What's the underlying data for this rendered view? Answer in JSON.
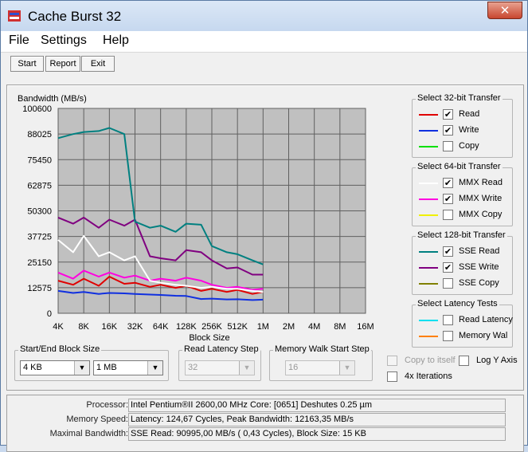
{
  "window": {
    "title": "Cache Burst 32",
    "close_label": "✕"
  },
  "menu": [
    "File",
    "Settings",
    "Help"
  ],
  "toolbar": {
    "start": "Start",
    "report": "Report",
    "exit": "Exit"
  },
  "chart": {
    "ylabel": "Bandwidth (MB/s)",
    "xlabel": "Block Size"
  },
  "chart_data": {
    "type": "line",
    "title": "",
    "ylabel": "Bandwidth (MB/s)",
    "xlabel": "Block Size",
    "ylim": [
      0,
      100600
    ],
    "y_ticks": [
      "100600",
      "88025",
      "75450",
      "62875",
      "50300",
      "37725",
      "25150",
      "12575",
      "0"
    ],
    "x_ticks": [
      "4K",
      "8K",
      "16K",
      "32K",
      "64K",
      "128K",
      "256K",
      "512K",
      "1M",
      "2M",
      "4M",
      "8M",
      "16M"
    ],
    "x_scale": "log2",
    "grid": true,
    "series": [
      {
        "name": "Read",
        "color": "#e00000",
        "x_kb": [
          4,
          6,
          8,
          12,
          16,
          24,
          32,
          48,
          64,
          96,
          128,
          192,
          256,
          384,
          512,
          768,
          1024
        ],
        "values": [
          16000,
          14000,
          17000,
          13500,
          18000,
          14500,
          15000,
          13000,
          14000,
          12500,
          13500,
          11000,
          12000,
          10500,
          11500,
          9500,
          10500
        ]
      },
      {
        "name": "Write",
        "color": "#1030e0",
        "x_kb": [
          4,
          6,
          8,
          12,
          16,
          24,
          32,
          48,
          64,
          96,
          128,
          192,
          256,
          384,
          512,
          768,
          1024
        ],
        "values": [
          11000,
          10000,
          10500,
          9500,
          10000,
          9800,
          9500,
          9200,
          9000,
          8600,
          8500,
          7000,
          7200,
          6800,
          6900,
          6500,
          6700
        ]
      },
      {
        "name": "MMX Read",
        "color": "#ffffff",
        "x_kb": [
          4,
          6,
          8,
          12,
          16,
          24,
          32,
          48,
          64,
          96,
          128,
          192,
          256,
          384,
          512,
          768,
          1024
        ],
        "values": [
          36000,
          30000,
          38000,
          28000,
          30000,
          26000,
          28000,
          16000,
          15000,
          14000,
          13500,
          12500,
          13000,
          12000,
          12000,
          11000,
          10500
        ]
      },
      {
        "name": "MMX Write",
        "color": "#ff00e0",
        "x_kb": [
          4,
          6,
          8,
          12,
          16,
          24,
          32,
          48,
          64,
          96,
          128,
          192,
          256,
          384,
          512,
          768,
          1024
        ],
        "values": [
          20000,
          17000,
          21000,
          18000,
          20000,
          17500,
          18500,
          16000,
          17000,
          16000,
          17500,
          16000,
          14000,
          12500,
          13000,
          11500,
          12000
        ]
      },
      {
        "name": "SSE Read",
        "color": "#008080",
        "x_kb": [
          4,
          6,
          8,
          12,
          16,
          24,
          32,
          48,
          64,
          96,
          128,
          192,
          256,
          384,
          512,
          768,
          1024
        ],
        "values": [
          86000,
          88000,
          89000,
          89500,
          91000,
          88000,
          45000,
          42000,
          43000,
          40000,
          44000,
          43500,
          33000,
          30000,
          29000,
          26000,
          24000
        ]
      },
      {
        "name": "SSE Write",
        "color": "#800080",
        "x_kb": [
          4,
          6,
          8,
          12,
          16,
          24,
          32,
          48,
          64,
          96,
          128,
          192,
          256,
          384,
          512,
          768,
          1024
        ],
        "values": [
          47000,
          44000,
          47000,
          42000,
          46000,
          43000,
          46000,
          28000,
          27000,
          26000,
          31000,
          30000,
          26000,
          22000,
          22500,
          19000,
          19000
        ]
      }
    ]
  },
  "groups": {
    "g32": {
      "title": "Select 32-bit Transfer",
      "items": [
        {
          "label": "Read",
          "color": "#e00000",
          "checked": "✔"
        },
        {
          "label": "Write",
          "color": "#1030e0",
          "checked": "✔"
        },
        {
          "label": "Copy",
          "color": "#00e000",
          "checked": ""
        }
      ]
    },
    "g64": {
      "title": "Select 64-bit Transfer",
      "items": [
        {
          "label": "MMX Read",
          "color": "#ffffff",
          "checked": "✔"
        },
        {
          "label": "MMX Write",
          "color": "#ff00e0",
          "checked": "✔"
        },
        {
          "label": "MMX Copy",
          "color": "#f0f000",
          "checked": ""
        }
      ]
    },
    "g128": {
      "title": "Select 128-bit Transfer",
      "items": [
        {
          "label": "SSE Read",
          "color": "#008080",
          "checked": "✔"
        },
        {
          "label": "SSE Write",
          "color": "#800080",
          "checked": "✔"
        },
        {
          "label": "SSE Copy",
          "color": "#808000",
          "checked": ""
        }
      ]
    },
    "glat": {
      "title": "Select Latency Tests",
      "items": [
        {
          "label": "Read Latency",
          "color": "#00e0f0",
          "checked": ""
        },
        {
          "label": "Memory Wal",
          "color": "#ff8000",
          "checked": ""
        }
      ]
    }
  },
  "block_size": {
    "title": "Start/End Block Size",
    "start": "4 KB",
    "end": "1 MB"
  },
  "read_latency": {
    "title": "Read Latency Step",
    "value": "32"
  },
  "memwalk": {
    "title": "Memory Walk Start Step",
    "value": "16"
  },
  "options": {
    "copy_to_itself": "Copy to itself",
    "log_y_axis": "Log Y Axis",
    "iterations": "4x Iterations"
  },
  "info": [
    {
      "label": "Processor:",
      "value": "Intel Pentium®II 2600,00 MHz   Core: [0651] Deshutes 0.25 µm"
    },
    {
      "label": "Memory Speed:",
      "value": "Latency: 124,67 Cycles, Peak Bandwidth: 12163,35 MB/s"
    },
    {
      "label": "Maximal Bandwidth:",
      "value": "SSE Read: 90995,00 MB/s ( 0,43 Cycles), Block Size:    15 KB"
    }
  ]
}
